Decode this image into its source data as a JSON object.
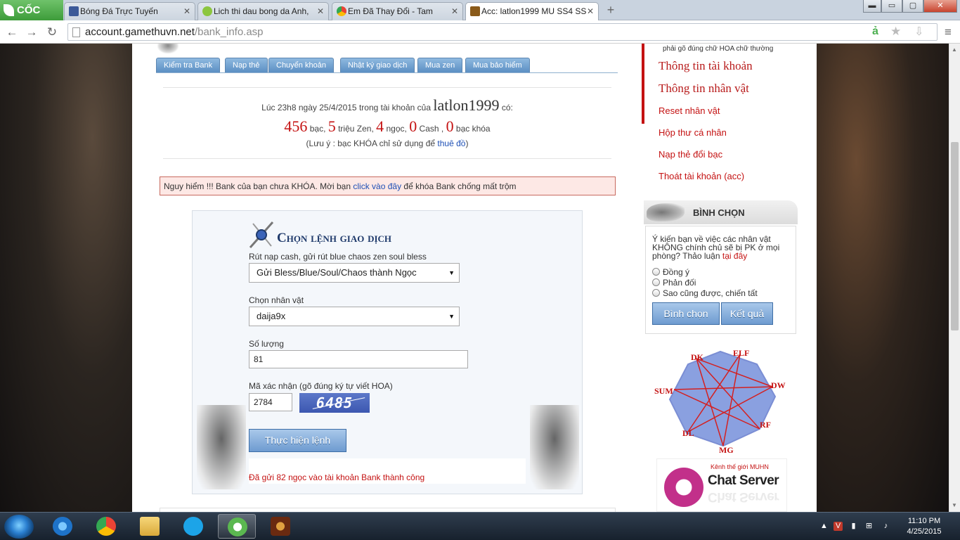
{
  "browser": {
    "brand": "CỐC CỐC",
    "tabs": [
      {
        "label": "Bóng Đá Trực Tuyến",
        "close": "✕",
        "favicon_color": "#3b5998"
      },
      {
        "label": "Lich thi dau bong da Anh,",
        "close": "✕",
        "favicon_color": "#8cc63f"
      },
      {
        "label": "Em Đã Thay Đổi - Tam",
        "close": "✕",
        "favicon_color": "#e25b2d"
      },
      {
        "label": "Acc: latlon1999 MU SS4 SS",
        "close": "✕",
        "favicon_color": "#8a5a1a"
      }
    ],
    "url_host": "account.gamethuvn.net",
    "url_path": "/bank_info.asp"
  },
  "page": {
    "subtabs": [
      "Kiểm tra Bank",
      "Nạp thẻ",
      "Chuyển khoản",
      "Nhật ký giao dịch",
      "Mua zen",
      "Mua bảo hiểm"
    ],
    "summary": {
      "prefix": "Lúc 23h8 ngày 25/4/2015 trong tài khoản của",
      "username": "latlon1999",
      "suffix": "có:",
      "bac_value": "456",
      "bac_label": "bạc,",
      "zen_value": "5",
      "zen_label": "triệu Zen,",
      "ngoc_value": "4",
      "ngoc_label": "ngọc,",
      "cash_value": "0",
      "cash_label": "Cash ,",
      "bac_khoa_value": "0",
      "bac_khoa_label": "bạc khóa",
      "note_prefix": "(Lưu ý : bạc KHÓA chỉ sử dụng để",
      "note_link": "thuê đồ",
      "note_suffix": ")"
    },
    "warning": {
      "prefix": "Nguy hiểm !!! Bank của bạn chưa KHÓA. Mời bạn",
      "link": "click vào đây",
      "suffix": "để khóa Bank chống mất trộm"
    },
    "form": {
      "title": "Chọn lệnh giao dịch",
      "command_label": "Rút nạp cash, gửi rút blue chaos zen soul bless",
      "command_value": "Gửi Bless/Blue/Soul/Chaos thành Ngọc",
      "character_label": "Chọn nhân vật",
      "character_value": "daija9x",
      "quantity_label": "Số lượng",
      "quantity_value": "81",
      "captcha_label": "Mã xác nhận (gõ đúng ký tự viết HOA)",
      "captcha_input": "2784",
      "captcha_image_text": "6485",
      "submit_label": "Thực hiện lệnh",
      "result": "Đã gửi 82 ngọc vào tài khoản Bank thành công"
    }
  },
  "sidebar": {
    "note": "phải gõ đúng chữ HOA chữ thường",
    "big_links": [
      "Thông tin tài khoản",
      "Thông tin nhân vật"
    ],
    "links": [
      "Reset nhân vật",
      "Hộp thư cá nhân",
      "Nạp thẻ đổi bạc",
      "Thoát tài khoản (acc)"
    ],
    "poll": {
      "heading": "BÌNH CHỌN",
      "question": "Ý kiến bạn về việc các nhân vật KHÔNG chính chủ sẽ bị PK ở mọi phòng? Thảo luận",
      "question_link": "tại đây",
      "options": [
        "Đồng ý",
        "Phản đối",
        "Sao cũng được, chiến tất"
      ],
      "vote_label": "Bình chọn",
      "result_label": "Kết quả"
    },
    "classes": [
      "DK",
      "ELF",
      "DW",
      "RF",
      "MG",
      "DL",
      "SUM"
    ],
    "chat_banner": {
      "tagline": "Kênh thế giới MUHN",
      "title": "Chat Server"
    }
  },
  "taskbar": {
    "time": "11:10 PM",
    "date": "4/25/2015"
  },
  "colors": {
    "accent_red": "#c41212",
    "link_blue": "#1d4fb5",
    "tab_blue": "#5b8fc3"
  }
}
